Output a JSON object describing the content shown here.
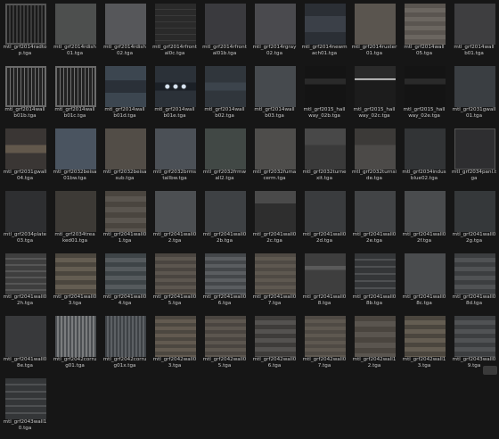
{
  "items": [
    {
      "label": "mtl_grf2014radto\np.tga",
      "tex": "t-grate"
    },
    {
      "label": "mtl_grf2014rdish\n01.tga",
      "tex": "t-dish"
    },
    {
      "label": "mtl_grf2014rdish\n02.tga",
      "tex": "t-dish2"
    },
    {
      "label": "mtl_grf2014rfront\nal0c.tga",
      "tex": "t-front"
    },
    {
      "label": "mtl_grf2014rfront\nal01b.tga",
      "tex": "t-front2"
    },
    {
      "label": "mtl_grf2014rgray\n02.tga",
      "tex": "t-gray"
    },
    {
      "label": "mtl_grf2014newm\nach01.tga",
      "tex": "t-mach"
    },
    {
      "label": "mtl_grf2014ruster\n01.tga",
      "tex": "t-rust"
    },
    {
      "label": "mtl_grf2014wall\n05.tga",
      "tex": "t-wall05"
    },
    {
      "label": "mtl_grf2014wall\nb01.tga",
      "tex": "t-wallb01"
    },
    {
      "label": "mtl_grf2014wall\nb01b.tga",
      "tex": "t-cage"
    },
    {
      "label": "mtl_grf2014wall\nb01c.tga",
      "tex": "t-cage"
    },
    {
      "label": "mtl_grf2014wall\nb01d.tga",
      "tex": "t-wallb01c"
    },
    {
      "label": "mtl_grf2014wall\nb01e.tga",
      "tex": "t-lights"
    },
    {
      "label": "mtl_grf2014wall\nb02.tga",
      "tex": "t-wallb01e"
    },
    {
      "label": "mtl_grf2014wall\nb03.tga",
      "tex": "t-wallb02"
    },
    {
      "label": "mtl_grf2015_hall\nway_02b.tga",
      "tex": "t-hall"
    },
    {
      "label": "mtl_grf2015_hall\nway_02c.tga",
      "tex": "t-hall2"
    },
    {
      "label": "mtl_grf2015_hall\nway_02e.tga",
      "tex": "t-hall"
    },
    {
      "label": "mtl_grf2031gwall\n01.tga",
      "tex": "t-wallb03"
    },
    {
      "label": "mtl_grf2031gwall\n04.tga",
      "tex": "t-wall04"
    },
    {
      "label": "mtl_grf2032beisa\n01bw.tga",
      "tex": "t-blue"
    },
    {
      "label": "mtl_grf2032beisa\nsub.tga",
      "tex": "t-sub"
    },
    {
      "label": "mtl_grf2032brms\ntallbw.tga",
      "tex": "t-tall"
    },
    {
      "label": "mtl_grf2032frmw\nall2.tga",
      "tex": "t-green"
    },
    {
      "label": "mtl_grf2032fuma\ncerm.tga",
      "tex": "t-cerm"
    },
    {
      "label": "mtl_grf2032turne\nxit.tga",
      "tex": "t-rust2"
    },
    {
      "label": "mtl_grf2032turnsi\nde.tga",
      "tex": "t-hrum"
    },
    {
      "label": "mtl_grf2034indus\nblue02.tga",
      "tex": "t-blue2"
    },
    {
      "label": "mtl_grf2034panl.t\nga",
      "tex": "t-panl"
    },
    {
      "label": "mtl_grf2034plate\n03.tga",
      "tex": "t-plate"
    },
    {
      "label": "mtl_grf2034trea\nked01.tga",
      "tex": "t-tread"
    },
    {
      "label": "mtl_grf2041wall0\n1.tga",
      "tex": "t-w1"
    },
    {
      "label": "mtl_grf2041wall0\n2.tga",
      "tex": "t-w2"
    },
    {
      "label": "mtl_grf2041wall0\n2b.tga",
      "tex": "t-w2b"
    },
    {
      "label": "mtl_grf2041wall0\n2c.tga",
      "tex": "t-w2c"
    },
    {
      "label": "mtl_grf2041wall0\n2d.tga",
      "tex": "t-w2d"
    },
    {
      "label": "mtl_grf2041wall0\n2e.tga",
      "tex": "t-w2e"
    },
    {
      "label": "mtl_grf2041wall0\n2f.tga",
      "tex": "t-w2f"
    },
    {
      "label": "mtl_grf2041wall0\n2g.tga",
      "tex": "t-w2g"
    },
    {
      "label": "mtl_grf2041wall0\n2h.tga",
      "tex": "t-w2h"
    },
    {
      "label": "mtl_grf2041wall0\n3.tga",
      "tex": "t-w3"
    },
    {
      "label": "mtl_grf2041wall0\n4.tga",
      "tex": "t-w4"
    },
    {
      "label": "mtl_grf2041wall0\n5.tga",
      "tex": "t-w5"
    },
    {
      "label": "mtl_grf2041wall0\n6.tga",
      "tex": "t-w6"
    },
    {
      "label": "mtl_grf2041wall0\n7.tga",
      "tex": "t-w7"
    },
    {
      "label": "mtl_grf2041wall0\n8.tga",
      "tex": "t-w8"
    },
    {
      "label": "mtl_grf2041wall0\n8b.tga",
      "tex": "t-w8b"
    },
    {
      "label": "mtl_grf2041wall0\n8c.tga",
      "tex": "t-w8c"
    },
    {
      "label": "mtl_grf2041wall0\n8d.tga",
      "tex": "t-w8d"
    },
    {
      "label": "mtl_grf2041wall0\n8e.tga",
      "tex": "t-w8e"
    },
    {
      "label": "mtl_grf2042corru\ng01.tga",
      "tex": "t-corru"
    },
    {
      "label": "mtl_grf2042corru\ng01x.tga",
      "tex": "t-corru2"
    },
    {
      "label": "mtl_grf2042wall0\n3.tga",
      "tex": "t-mix"
    },
    {
      "label": "mtl_grf2042wall0\n5.tga",
      "tex": "t-w5"
    },
    {
      "label": "mtl_grf2042wall0\n6.tga",
      "tex": "t-mix2"
    },
    {
      "label": "mtl_grf2042wall0\n7.tga",
      "tex": "t-w7"
    },
    {
      "label": "mtl_grf2042wall1\n2.tga",
      "tex": "t-w1"
    },
    {
      "label": "mtl_grf2042wall1\n3.tga",
      "tex": "t-w3"
    },
    {
      "label": "mtl_grf2043wall0\n9.tga",
      "tex": "t-w8d"
    },
    {
      "label": "mtl_grf2043wall1\n0.tga",
      "tex": "t-w8b"
    }
  ]
}
